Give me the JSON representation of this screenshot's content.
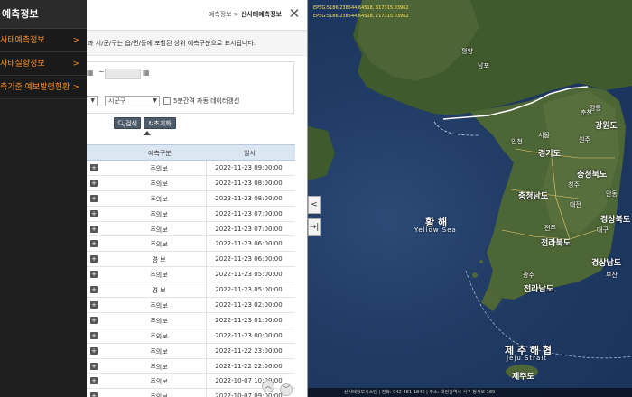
{
  "sidebar": {
    "title": "예측정보",
    "items": [
      {
        "label": "사태예측정보"
      },
      {
        "label": "사태실황정보"
      },
      {
        "label": "측기준 예보발령현황"
      }
    ]
  },
  "panel": {
    "breadcrumb_parent": "예측정보 >",
    "breadcrumb_current": "산사태예측정보",
    "description": "과 시/군/구는 읍/면/동에 포함된 상위 예측구분으로 표시됩니다.",
    "date_separator": "~",
    "select_sigungu": "시군구",
    "auto_refresh_label": "5분간격 자동 데이터갱신",
    "search_button": "검색",
    "reset_button": "초기화",
    "table": {
      "col_category": "예측구분",
      "col_datetime": "일시",
      "rows": [
        {
          "category": "주의보",
          "datetime": "2022-11-23 09:00:00"
        },
        {
          "category": "주의보",
          "datetime": "2022-11-23 08:00:00"
        },
        {
          "category": "주의보",
          "datetime": "2022-11-23 08:00:00"
        },
        {
          "category": "주의보",
          "datetime": "2022-11-23 07:00:00"
        },
        {
          "category": "주의보",
          "datetime": "2022-11-23 07:00:00"
        },
        {
          "category": "주의보",
          "datetime": "2022-11-23 06:00:00"
        },
        {
          "category": "경 보",
          "datetime": "2022-11-23 06:00:00"
        },
        {
          "category": "주의보",
          "datetime": "2022-11-23 05:00:00"
        },
        {
          "category": "경 보",
          "datetime": "2022-11-23 05:00:00"
        },
        {
          "category": "주의보",
          "datetime": "2022-11-23 02:00:00"
        },
        {
          "category": "주의보",
          "datetime": "2022-11-23 01:00:00"
        },
        {
          "category": "주의보",
          "datetime": "2022-11-23 00:00:00"
        },
        {
          "category": "주의보",
          "datetime": "2022-11-22 23:00:00"
        },
        {
          "category": "주의보",
          "datetime": "2022-11-22 22:00:00"
        },
        {
          "category": "주의보",
          "datetime": "2022-10-07 10:00:00"
        },
        {
          "category": "주의보",
          "datetime": "2022-10-07 09:00:00"
        }
      ]
    }
  },
  "map": {
    "coord_line1": "EPSG:5186 238544.64518, 617315.03962",
    "coord_line2": "EPSG:5186 238544.64518, 717315.03962",
    "labels": {
      "gangwon": "강원도",
      "gyeonggi": "경기도",
      "chungbuk": "충청북도",
      "chungnam": "충청남도",
      "jeonbuk": "전라북도",
      "gyeongbuk": "경상북도",
      "gyeongnam": "경상남도",
      "jeonnam": "전라남도",
      "jeju": "제주도",
      "seoul": "서울",
      "daejeon": "대전",
      "yellow_sea_ko": "황 해",
      "yellow_sea_en": "Yellow Sea",
      "jeju_strait_ko": "제 주 해 협",
      "jeju_strait_en": "Jeju Strait",
      "pyongyang": "평양",
      "nampo": "남포",
      "chuncheon": "춘천",
      "gangneung": "강릉",
      "wonju": "원주",
      "cheongju": "청주",
      "andong": "안동",
      "gwangju": "광주",
      "jeonju": "전주",
      "daegu": "대구",
      "busan": "부산",
      "incheon": "인천"
    },
    "footer": "산사태정보시스템 | 전화: 042-481-1840 | 주소: 대전광역시 서구 청사로 189"
  },
  "colors": {
    "sidebar_accent": "#ff8a1f",
    "table_header": "#dbe6f3",
    "button": "#4d5a69"
  }
}
